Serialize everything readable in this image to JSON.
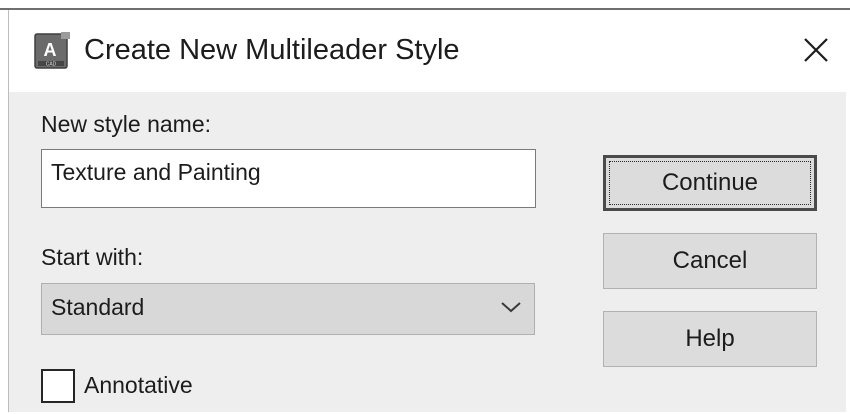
{
  "dialog": {
    "title": "Create New Multileader Style",
    "app_icon": "autocad-app-icon",
    "close_icon": "close-icon"
  },
  "form": {
    "new_style_name_label": "New style name:",
    "new_style_name_value": "Texture and Painting",
    "start_with_label": "Start with:",
    "start_with_value": "Standard",
    "annotative_label": "Annotative",
    "annotative_checked": false
  },
  "buttons": {
    "continue_label": "Continue",
    "cancel_label": "Cancel",
    "help_label": "Help"
  }
}
